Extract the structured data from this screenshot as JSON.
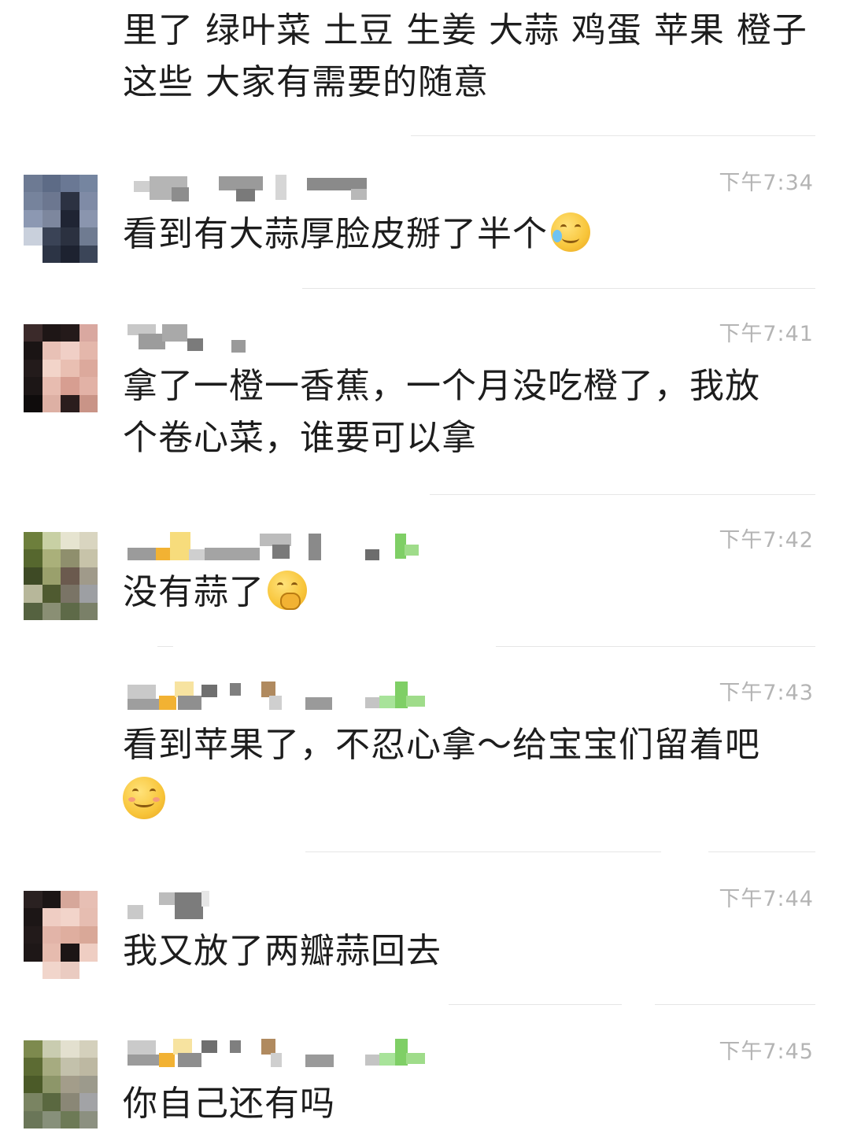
{
  "messages": [
    {
      "text_lines": [
        "里了 绿叶菜 土豆 生姜 大蒜 鸡蛋 苹果 橙子",
        "这些 大家有需要的随意"
      ]
    },
    {
      "time": "下午7:34",
      "text": "看到有大蒜厚脸皮掰了半个",
      "emoji": "facepalm-emoji"
    },
    {
      "time": "下午7:41",
      "text_lines": [
        "拿了一橙一香蕉，一个月没吃橙了，我放",
        "个卷心菜，谁要可以拿"
      ]
    },
    {
      "time": "下午7:42",
      "text": "没有蒜了",
      "emoji": "hand-over-mouth-emoji"
    },
    {
      "time": "下午7:43",
      "text_lines": [
        "看到苹果了，不忍心拿～给宝宝们留着吧"
      ],
      "emoji": "smiling-emoji"
    },
    {
      "time": "下午7:44",
      "text": "我又放了两瓣蒜回去"
    },
    {
      "time": "下午7:45",
      "text": "你自己还有吗"
    }
  ],
  "colors": {
    "background": "#ffffff",
    "text": "#1d1d1d",
    "timestamp": "#b4b4b4",
    "divider": "#e6e6e6"
  }
}
